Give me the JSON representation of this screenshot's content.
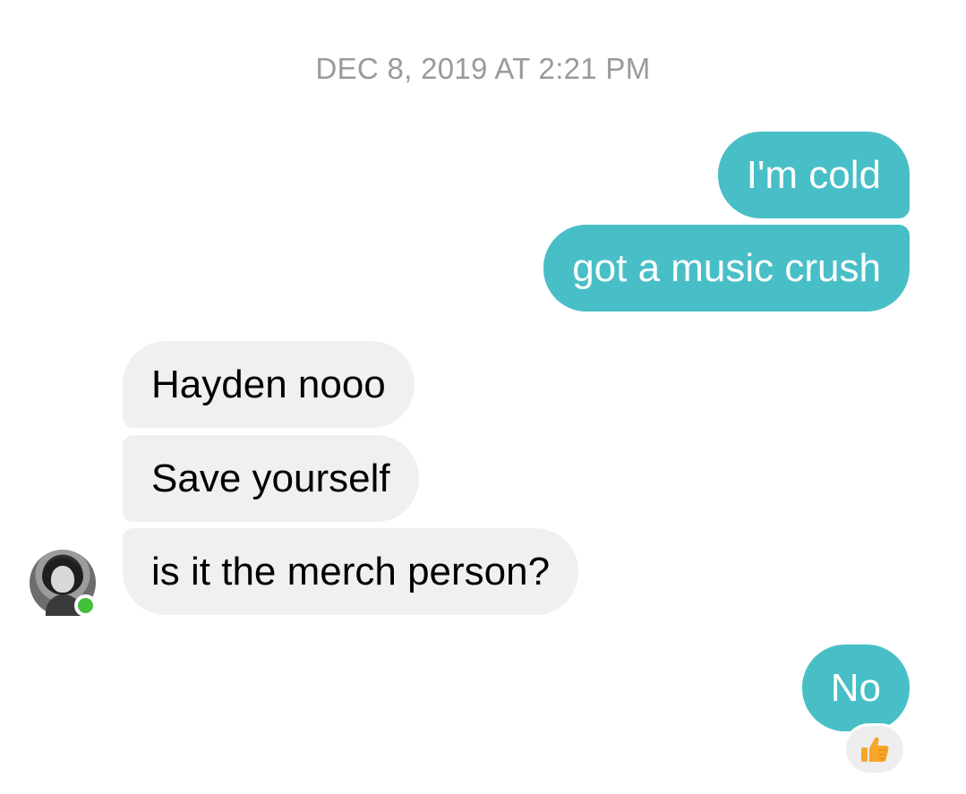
{
  "conversation": {
    "timestamp": "DEC 8, 2019 AT 2:21 PM",
    "messages": [
      {
        "direction": "outgoing",
        "text": "I'm cold"
      },
      {
        "direction": "outgoing",
        "text": "got a music crush"
      },
      {
        "direction": "incoming",
        "text": "Hayden nooo"
      },
      {
        "direction": "incoming",
        "text": "Save yourself"
      },
      {
        "direction": "incoming",
        "text": "is it the merch person?"
      },
      {
        "direction": "outgoing",
        "text": "No"
      }
    ],
    "reaction": {
      "icon": "thumbs-up-icon",
      "color": "#f7a62a"
    },
    "online_status_color": "#44c03b"
  },
  "colors": {
    "outgoing_bubble": "#48bfc7",
    "incoming_bubble": "#f0f0f0",
    "timestamp_text": "#9a9a9a"
  }
}
